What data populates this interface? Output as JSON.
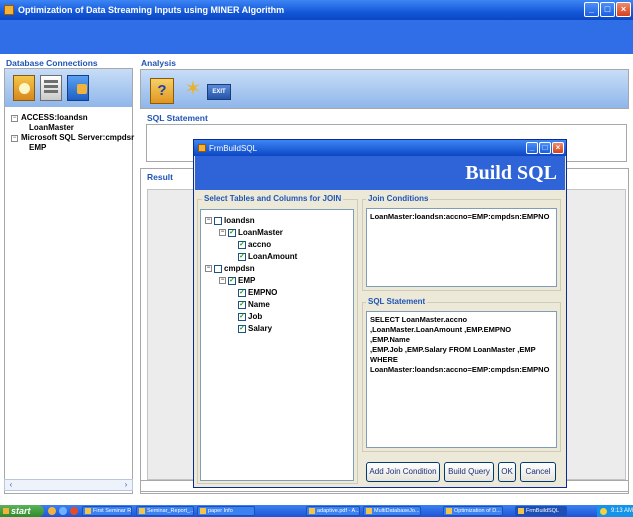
{
  "window": {
    "title": "Optimization of Data Streaming Inputs using MINER Algorithm"
  },
  "window_buttons": {
    "minimize": "_",
    "maximize": "□",
    "close": "×"
  },
  "db_panel": {
    "title": "Database Connections",
    "tree": [
      {
        "label": "ACCESS:loandsn",
        "children": [
          "LoanMaster"
        ]
      },
      {
        "label": "Microsoft SQL Server:cmpdsr",
        "children": [
          "EMP"
        ]
      }
    ]
  },
  "analysis": {
    "title": "Analysis",
    "exit_label": "EXIT",
    "help_icon_glyph": "?",
    "sql_statement_label": "SQL Statement",
    "result_label": "Result"
  },
  "dialog": {
    "title": "FrmBuildSQL",
    "header": "Build SQL",
    "tables_group_label": "Select Tables and Columns for JOIN",
    "join_group_label": "Join Conditions",
    "sql_group_label": "SQL Statement",
    "tree": [
      {
        "label": "loandsn",
        "checked": false,
        "level": 0,
        "expander": "−"
      },
      {
        "label": "LoanMaster",
        "checked": true,
        "level": 1,
        "expander": "−"
      },
      {
        "label": "accno",
        "checked": true,
        "level": 2
      },
      {
        "label": "LoanAmount",
        "checked": true,
        "level": 2
      },
      {
        "label": "cmpdsn",
        "checked": false,
        "level": 0,
        "expander": "−"
      },
      {
        "label": "EMP",
        "checked": true,
        "level": 1,
        "expander": "−"
      },
      {
        "label": "EMPNO",
        "checked": true,
        "level": 2
      },
      {
        "label": "Name",
        "checked": true,
        "level": 2
      },
      {
        "label": "Job",
        "checked": true,
        "level": 2
      },
      {
        "label": "Salary",
        "checked": true,
        "level": 2
      }
    ],
    "check_glyph": "✓",
    "join_conditions": "LoanMaster:loandsn:accno=EMP:cmpdsn:EMPNO",
    "sql_statement": "SELECT LoanMaster.accno\n,LoanMaster.LoanAmount ,EMP.EMPNO ,EMP.Name\n,EMP.Job ,EMP.Salary FROM LoanMaster ,EMP\nWHERE\nLoanMaster:loandsn:accno=EMP:cmpdsn:EMPNO",
    "buttons": {
      "add_join": "Add Join Condition",
      "build_query": "Build Query",
      "ok": "OK",
      "cancel": "Cancel"
    }
  },
  "taskbar": {
    "start": "start",
    "tasks": [
      "First Seminar Re...",
      "Seminar_Report_...",
      "paper Info",
      "adaptive.pdf - A...",
      "MultiDatabaseJo...",
      "Optimization of D...",
      "FrmBuildSQL"
    ],
    "clock": "9:13 AM"
  }
}
